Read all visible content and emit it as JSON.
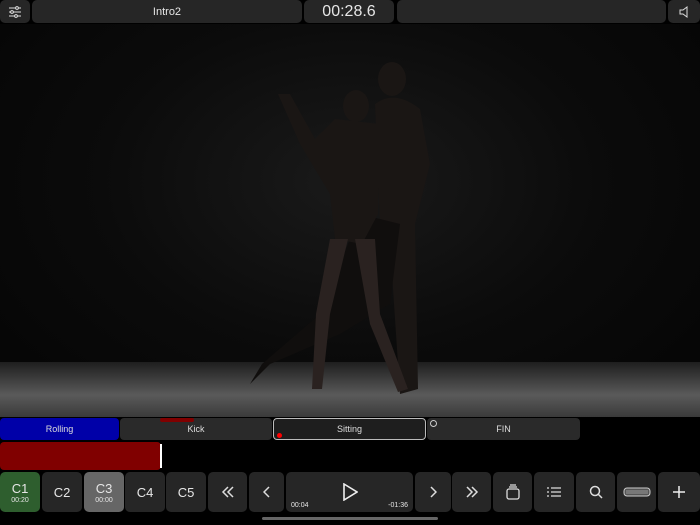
{
  "top_bar": {
    "clip_title": "Intro2",
    "timecode": "00:28.6",
    "settings_icon": "sliders-icon",
    "sound_icon": "speaker-icon"
  },
  "segments": [
    {
      "label": "Rolling",
      "color": "#0000a8"
    },
    {
      "label": "Kick",
      "color": "#2a2a2a"
    },
    {
      "label": "Sitting",
      "color": "#1e1e1e"
    },
    {
      "label": "FIN",
      "color": "#2a2a2a"
    }
  ],
  "progress": {
    "color": "#800000",
    "fraction": 0.23
  },
  "cameras": [
    {
      "label": "C1",
      "time": "00:20",
      "color": "#2e5e2e"
    },
    {
      "label": "C2",
      "time": ""
    },
    {
      "label": "C3",
      "time": "00:00",
      "color": "#666666"
    },
    {
      "label": "C4",
      "time": ""
    },
    {
      "label": "C5",
      "time": ""
    }
  ],
  "transport": {
    "elapsed": "00:04",
    "remaining": "-01:36"
  }
}
